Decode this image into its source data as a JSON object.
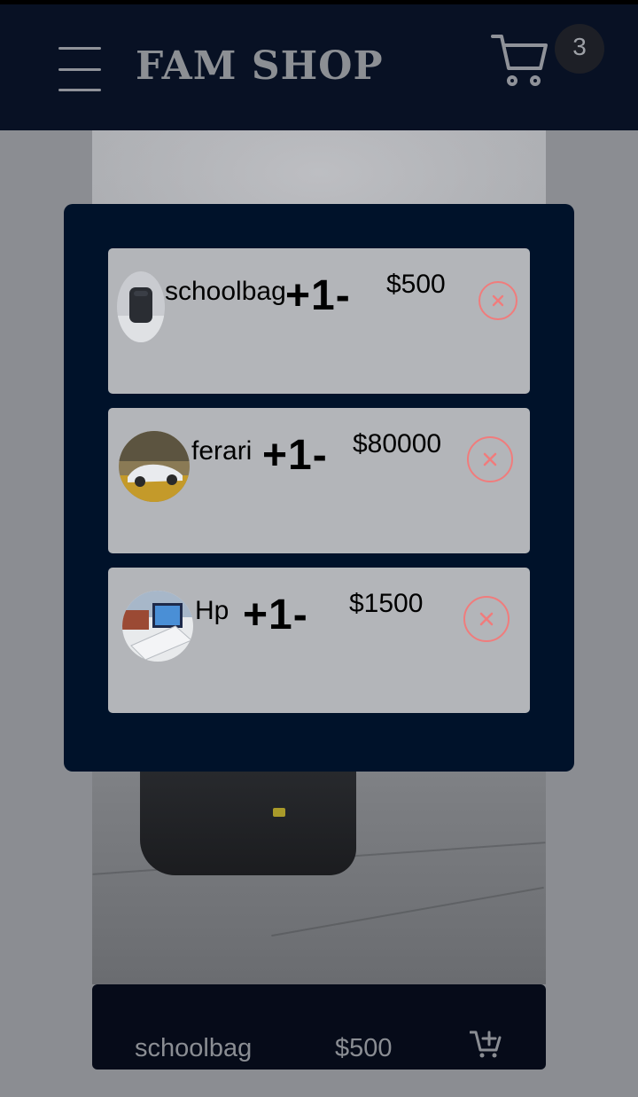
{
  "header": {
    "brand": "FAM SHOP",
    "cart_count": "3",
    "menu_icon": "hamburger-menu-icon",
    "cart_icon": "shopping-cart-icon"
  },
  "product": {
    "name": "schoolbag",
    "price": "$500",
    "add_icon": "add-to-cart-icon"
  },
  "cart": {
    "items": [
      {
        "name": "schoolbag",
        "plus": "+",
        "qty": "1",
        "minus": "-",
        "price": "$500",
        "remove_icon": "close-circle-icon"
      },
      {
        "name": "ferari",
        "plus": "+",
        "qty": "1",
        "minus": "-",
        "price": "$80000",
        "remove_icon": "close-circle-icon"
      },
      {
        "name": "Hp",
        "plus": "+",
        "qty": "1",
        "minus": "-",
        "price": "$1500",
        "remove_icon": "close-circle-icon"
      }
    ]
  },
  "colors": {
    "header_bg": "#081124",
    "modal_bg": "#00122a",
    "card_bg": "#b3b5b9",
    "remove_accent": "#f07c7c"
  }
}
